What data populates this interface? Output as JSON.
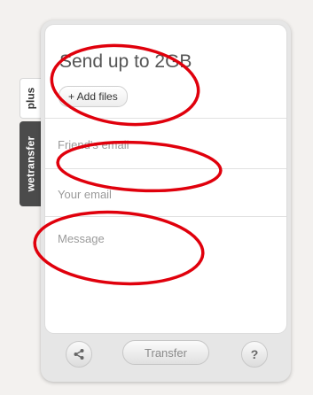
{
  "tabs": {
    "plus_label": "plus",
    "wetransfer_label": "wetransfer"
  },
  "form": {
    "title": "Send up to 2GB",
    "add_files_label": "+ Add files",
    "friend_email_placeholder": "Friend's email",
    "your_email_placeholder": "Your email",
    "message_placeholder": "Message"
  },
  "footer": {
    "transfer_label": "Transfer",
    "help_label": "?",
    "share_icon": "share-icon"
  },
  "annotations": {
    "color": "#e0000c",
    "marked_elements": [
      "add-files-button",
      "friend-email-field",
      "message-field"
    ]
  }
}
